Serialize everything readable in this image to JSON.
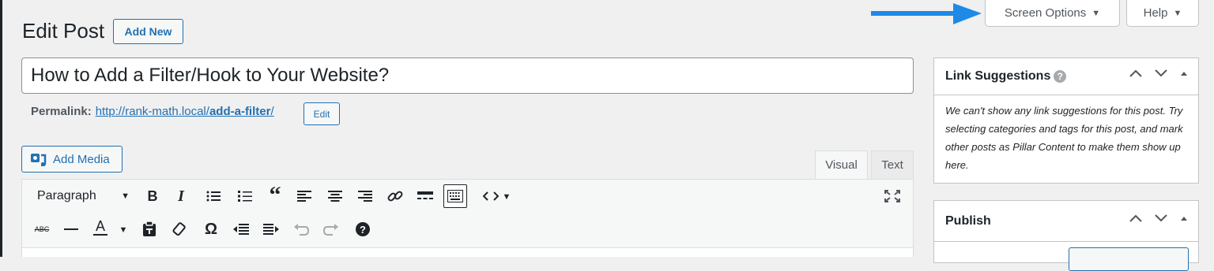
{
  "screen_meta": {
    "screen_options_label": "Screen Options",
    "help_label": "Help",
    "dropdown_glyph": "▼",
    "arrow_color": "#1e8ae6"
  },
  "page": {
    "title": "Edit Post",
    "add_new_label": "Add New"
  },
  "post": {
    "title_value": "How to Add a Filter/Hook to Your Website?",
    "permalink_label": "Permalink:",
    "permalink_base": "http://rank-math.local/",
    "permalink_slug": "add-a-filter",
    "permalink_trailing": "/",
    "permalink_edit_label": "Edit"
  },
  "editor": {
    "add_media_label": "Add Media",
    "tabs": {
      "visual": "Visual",
      "text": "Text"
    },
    "format_select_value": "Paragraph",
    "dropdown_glyph": "▼",
    "toolbar_row1_icons": [
      "bold-icon",
      "italic-icon",
      "bullet-list-icon",
      "numbered-list-icon",
      "blockquote-icon",
      "align-left-icon",
      "align-center-icon",
      "align-right-icon",
      "link-icon",
      "read-more-icon",
      "toolbar-toggle-icon",
      "code-icon",
      "fullscreen-icon"
    ],
    "toolbar_row2_icons": [
      "strikethrough-icon",
      "horizontal-line-icon",
      "text-color-icon",
      "paste-text-icon",
      "clear-formatting-icon",
      "special-character-icon",
      "outdent-icon",
      "indent-icon",
      "undo-icon",
      "redo-icon",
      "keyboard-shortcuts-icon"
    ],
    "glyphs": {
      "bold": "B",
      "italic": "I",
      "blockquote": "“",
      "strike": "ABC",
      "text_color": "A",
      "omega": "Ω",
      "help": "?"
    }
  },
  "sidebar": {
    "link_suggestions": {
      "title": "Link Suggestions",
      "help_glyph": "?",
      "body": "We can't show any link suggestions for this post. Try selecting categories and tags for this post, and mark other posts as Pillar Content to make them show up here."
    },
    "publish": {
      "title": "Publish"
    }
  }
}
